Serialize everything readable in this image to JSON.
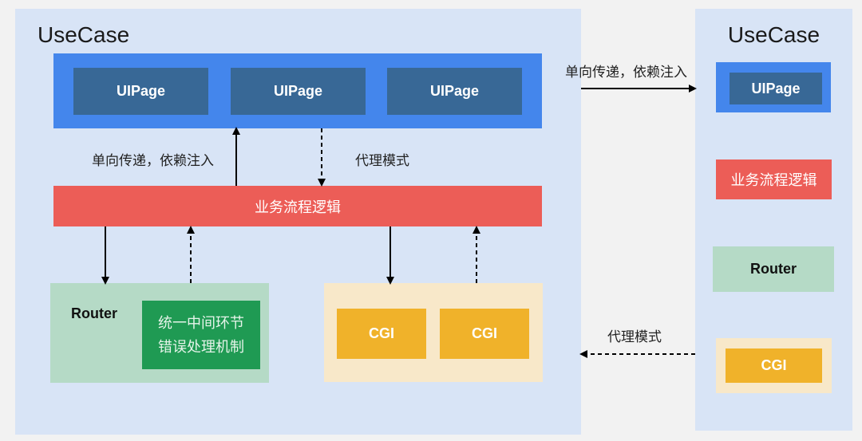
{
  "diagram": {
    "left_usecase": {
      "title": "UseCase",
      "ui_pages": [
        "UIPage",
        "UIPage",
        "UIPage"
      ],
      "business_logic": "业务流程逻辑",
      "router": {
        "label": "Router",
        "inner_lines": [
          "统一中间环节",
          "错误处理机制"
        ]
      },
      "cgis": [
        "CGI",
        "CGI"
      ],
      "edge_labels": {
        "logic_to_ui": "单向传递，依赖注入",
        "ui_to_logic": "代理模式"
      }
    },
    "right_usecase": {
      "title": "UseCase",
      "ui_page": "UIPage",
      "business_logic": "业务流程逻辑",
      "router": "Router",
      "cgi": "CGI"
    },
    "cross_edges": {
      "top": "单向传递，依赖注入",
      "bottom": "代理模式"
    },
    "colors": {
      "background": "#f2f2f2",
      "panel": "#d8e4f6",
      "ui_outer": "#4486ec",
      "ui_inner": "#386896",
      "business_logic": "#ec5d57",
      "router_outer": "#b5dac6",
      "router_inner": "#1f9a53",
      "cgi_outer": "#f8e8c9",
      "cgi_inner": "#f0b22a"
    }
  }
}
